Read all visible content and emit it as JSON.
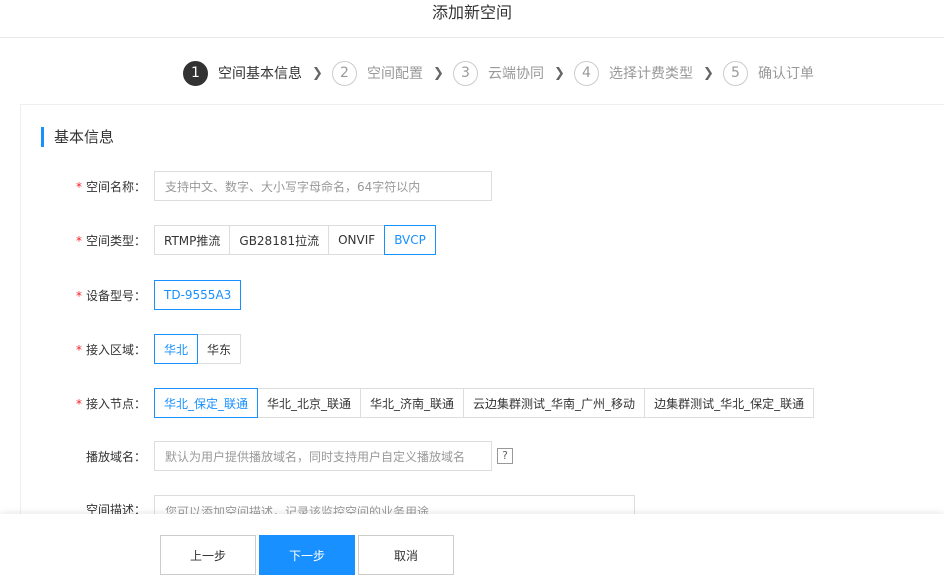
{
  "page": {
    "title": "添加新空间"
  },
  "steps": [
    {
      "num": "1",
      "label": "空间基本信息",
      "active": true
    },
    {
      "num": "2",
      "label": "空间配置"
    },
    {
      "num": "3",
      "label": "云端协同"
    },
    {
      "num": "4",
      "label": "选择计费类型"
    },
    {
      "num": "5",
      "label": "确认订单"
    }
  ],
  "section": {
    "title": "基本信息"
  },
  "form": {
    "required_mark": "*",
    "name": {
      "label": "空间名称：",
      "placeholder": "支持中文、数字、大小写字母命名，64字符以内"
    },
    "type": {
      "label": "空间类型：",
      "options": [
        "RTMP推流",
        "GB28181拉流",
        "ONVIF",
        "BVCP"
      ],
      "selected": "BVCP"
    },
    "device_model": {
      "label": "设备型号：",
      "options": [
        "TD-9555A3"
      ],
      "selected": "TD-9555A3"
    },
    "region": {
      "label": "接入区域：",
      "options": [
        "华北",
        "华东"
      ],
      "selected": "华北"
    },
    "node": {
      "label": "接入节点：",
      "options": [
        "华北_保定_联通",
        "华北_北京_联通",
        "华北_济南_联通",
        "云边集群测试_华南_广州_移动",
        "边集群测试_华北_保定_联通"
      ],
      "selected": "华北_保定_联通"
    },
    "play_domain": {
      "label": "播放域名：",
      "placeholder": "默认为用户提供播放域名，同时支持用户自定义播放域名",
      "help": "?"
    },
    "description": {
      "label": "空间描述：",
      "placeholder": "您可以添加空间描述，记录该监控空间的业务用途"
    }
  },
  "footer": {
    "prev": "上一步",
    "next": "下一步",
    "cancel": "取消"
  },
  "colors": {
    "accent": "#1890ff",
    "required": "#f5222d",
    "step_active": "#333333"
  },
  "icons": {
    "step_separator": "chevron-right-icon",
    "help": "question-mark-icon"
  }
}
